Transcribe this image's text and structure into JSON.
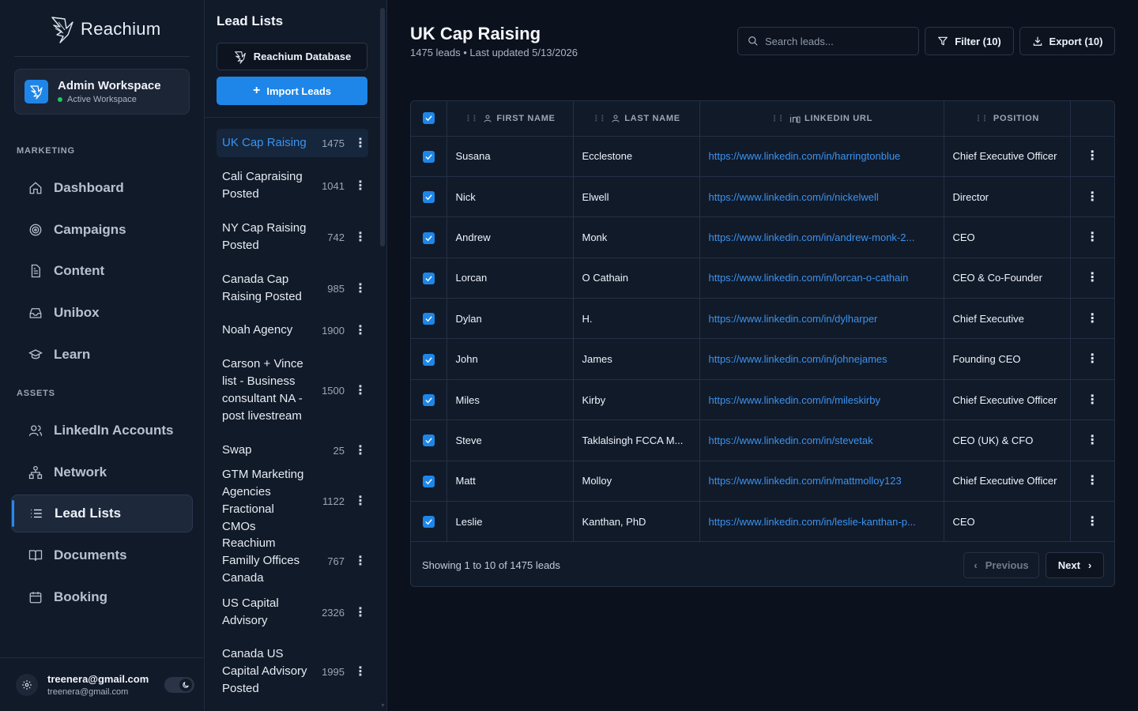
{
  "brand": {
    "name": "Reachium"
  },
  "workspace": {
    "name": "Admin Workspace",
    "status": "Active Workspace"
  },
  "sidebar": {
    "sections": [
      {
        "label": "MARKETING"
      },
      {
        "label": "ASSETS"
      }
    ],
    "items": [
      {
        "label": "Dashboard",
        "icon": "home-icon"
      },
      {
        "label": "Campaigns",
        "icon": "target-icon"
      },
      {
        "label": "Content",
        "icon": "document-icon"
      },
      {
        "label": "Unibox",
        "icon": "inbox-icon"
      },
      {
        "label": "Learn",
        "icon": "graduation-cap-icon"
      },
      {
        "label": "LinkedIn Accounts",
        "icon": "users-icon"
      },
      {
        "label": "Network",
        "icon": "network-icon"
      },
      {
        "label": "Lead Lists",
        "icon": "list-icon",
        "active": true
      },
      {
        "label": "Documents",
        "icon": "book-icon"
      },
      {
        "label": "Booking",
        "icon": "calendar-icon"
      }
    ]
  },
  "user": {
    "email_primary": "treenera@gmail.com",
    "email_secondary": "treenera@gmail.com"
  },
  "lists_panel": {
    "title": "Lead Lists",
    "database_button": "Reachium Database",
    "import_button": "Import Leads",
    "lists": [
      {
        "name": "UK Cap Raising",
        "count": "1475",
        "active": true
      },
      {
        "name": "Cali Capraising Posted",
        "count": "1041"
      },
      {
        "name": "NY Cap Raising Posted",
        "count": "742"
      },
      {
        "name": "Canada Cap Raising Posted",
        "count": "985"
      },
      {
        "name": "Noah Agency",
        "count": "1900"
      },
      {
        "name": "Carson + Vince list - Business consultant NA - post livestream",
        "count": "1500"
      },
      {
        "name": "Swap",
        "count": "25"
      },
      {
        "name": "GTM Marketing Agencies Fractional CMOs",
        "count": "1122"
      },
      {
        "name": "Reachium Familly Offices Canada",
        "count": "767"
      },
      {
        "name": "US Capital Advisory",
        "count": "2326"
      },
      {
        "name": "Canada US Capital Advisory Posted",
        "count": "1995"
      }
    ]
  },
  "main": {
    "title": "UK Cap Raising",
    "subtitle": "1475 leads • Last updated 5/13/2026",
    "search_placeholder": "Search leads...",
    "filter_label": "Filter (10)",
    "export_label": "Export (10)",
    "columns": [
      "FIRST NAME",
      "LAST NAME",
      "LINKEDIN URL",
      "POSITION"
    ],
    "rows": [
      {
        "first": "Susana",
        "last": "Ecclestone",
        "url": "https://www.linkedin.com/in/harringtonblue",
        "position": "Chief Executive Officer"
      },
      {
        "first": "Nick",
        "last": "Elwell",
        "url": "https://www.linkedin.com/in/nickelwell",
        "position": "Director"
      },
      {
        "first": "Andrew",
        "last": "Monk",
        "url": "https://www.linkedin.com/in/andrew-monk-2...",
        "position": "CEO"
      },
      {
        "first": "Lorcan",
        "last": "O Cathain",
        "url": "https://www.linkedin.com/in/lorcan-o-cathain",
        "position": "CEO & Co-Founder"
      },
      {
        "first": "Dylan",
        "last": "H.",
        "url": "https://www.linkedin.com/in/dylharper",
        "position": "Chief Executive"
      },
      {
        "first": "John",
        "last": "James",
        "url": "https://www.linkedin.com/in/johnejames",
        "position": "Founding CEO"
      },
      {
        "first": "Miles",
        "last": "Kirby",
        "url": "https://www.linkedin.com/in/mileskirby",
        "position": "Chief Executive Officer"
      },
      {
        "first": "Steve",
        "last": "Taklalsingh FCCA M...",
        "url": "https://www.linkedin.com/in/stevetak",
        "position": "CEO (UK) & CFO"
      },
      {
        "first": "Matt",
        "last": "Molloy",
        "url": "https://www.linkedin.com/in/mattmolloy123",
        "position": "Chief Executive Officer"
      },
      {
        "first": "Leslie",
        "last": "Kanthan, PhD",
        "url": "https://www.linkedin.com/in/leslie-kanthan-p...",
        "position": "CEO"
      }
    ],
    "pagination": {
      "text": "Showing 1 to 10 of 1475 leads",
      "prev": "Previous",
      "next": "Next"
    }
  },
  "colors": {
    "accent": "#1e86e8",
    "background": "#0b111d",
    "panel": "#111a29",
    "link": "#3b93f0"
  }
}
